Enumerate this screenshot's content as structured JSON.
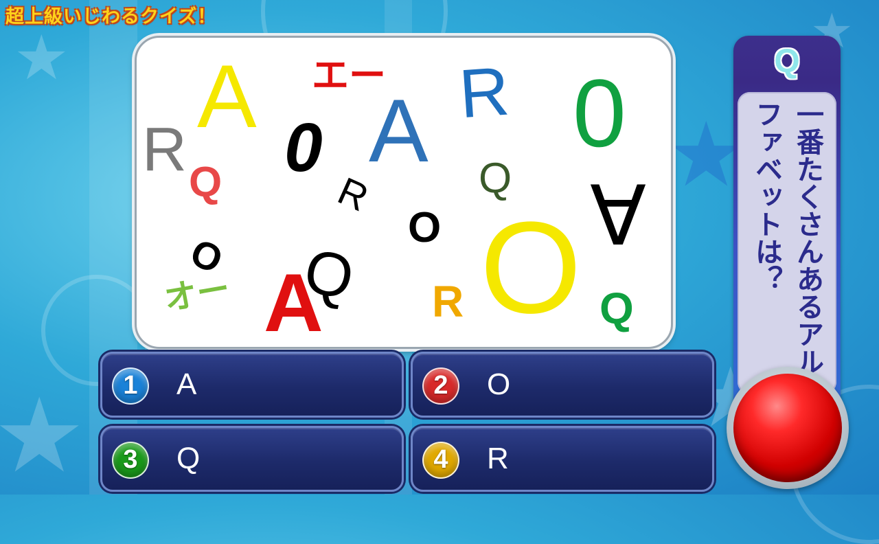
{
  "title": "超上級いじわるクイズ！",
  "question": {
    "marker": "Q",
    "text": "一番たくさんあるアルファベットは？"
  },
  "answers": [
    {
      "num": "1",
      "label": "A",
      "color": "#1a82d8"
    },
    {
      "num": "2",
      "label": "O",
      "color": "#d82a2a"
    },
    {
      "num": "3",
      "label": "Q",
      "color": "#1a9a1a"
    },
    {
      "num": "4",
      "label": "R",
      "color": "#e0a800"
    }
  ],
  "puzzle_glyphs": [
    {
      "text": "A",
      "color": "#f5e800"
    },
    {
      "text": "エー",
      "color": "#e01010"
    },
    {
      "text": "A",
      "color": "#2f72b8"
    },
    {
      "text": "R",
      "color": "#1f6fbf"
    },
    {
      "text": "0",
      "color": "#10a040"
    },
    {
      "text": "R",
      "color": "#7a7a7a"
    },
    {
      "text": "Q",
      "color": "#e84848"
    },
    {
      "text": "0",
      "color": "#000000"
    },
    {
      "text": "R",
      "color": "#000000"
    },
    {
      "text": "Q",
      "color": "#3a5a2a"
    },
    {
      "text": "∀",
      "color": "#000000"
    },
    {
      "text": "O",
      "color": "#000000"
    },
    {
      "text": "O",
      "color": "#f5e800"
    },
    {
      "text": "O",
      "color": "#000000"
    },
    {
      "text": "Q",
      "color": "#000000"
    },
    {
      "text": "A",
      "color": "#e01010"
    },
    {
      "text": "オー",
      "color": "#7ac040"
    },
    {
      "text": "R",
      "color": "#f0a800"
    },
    {
      "text": "Q",
      "color": "#10a040"
    }
  ]
}
